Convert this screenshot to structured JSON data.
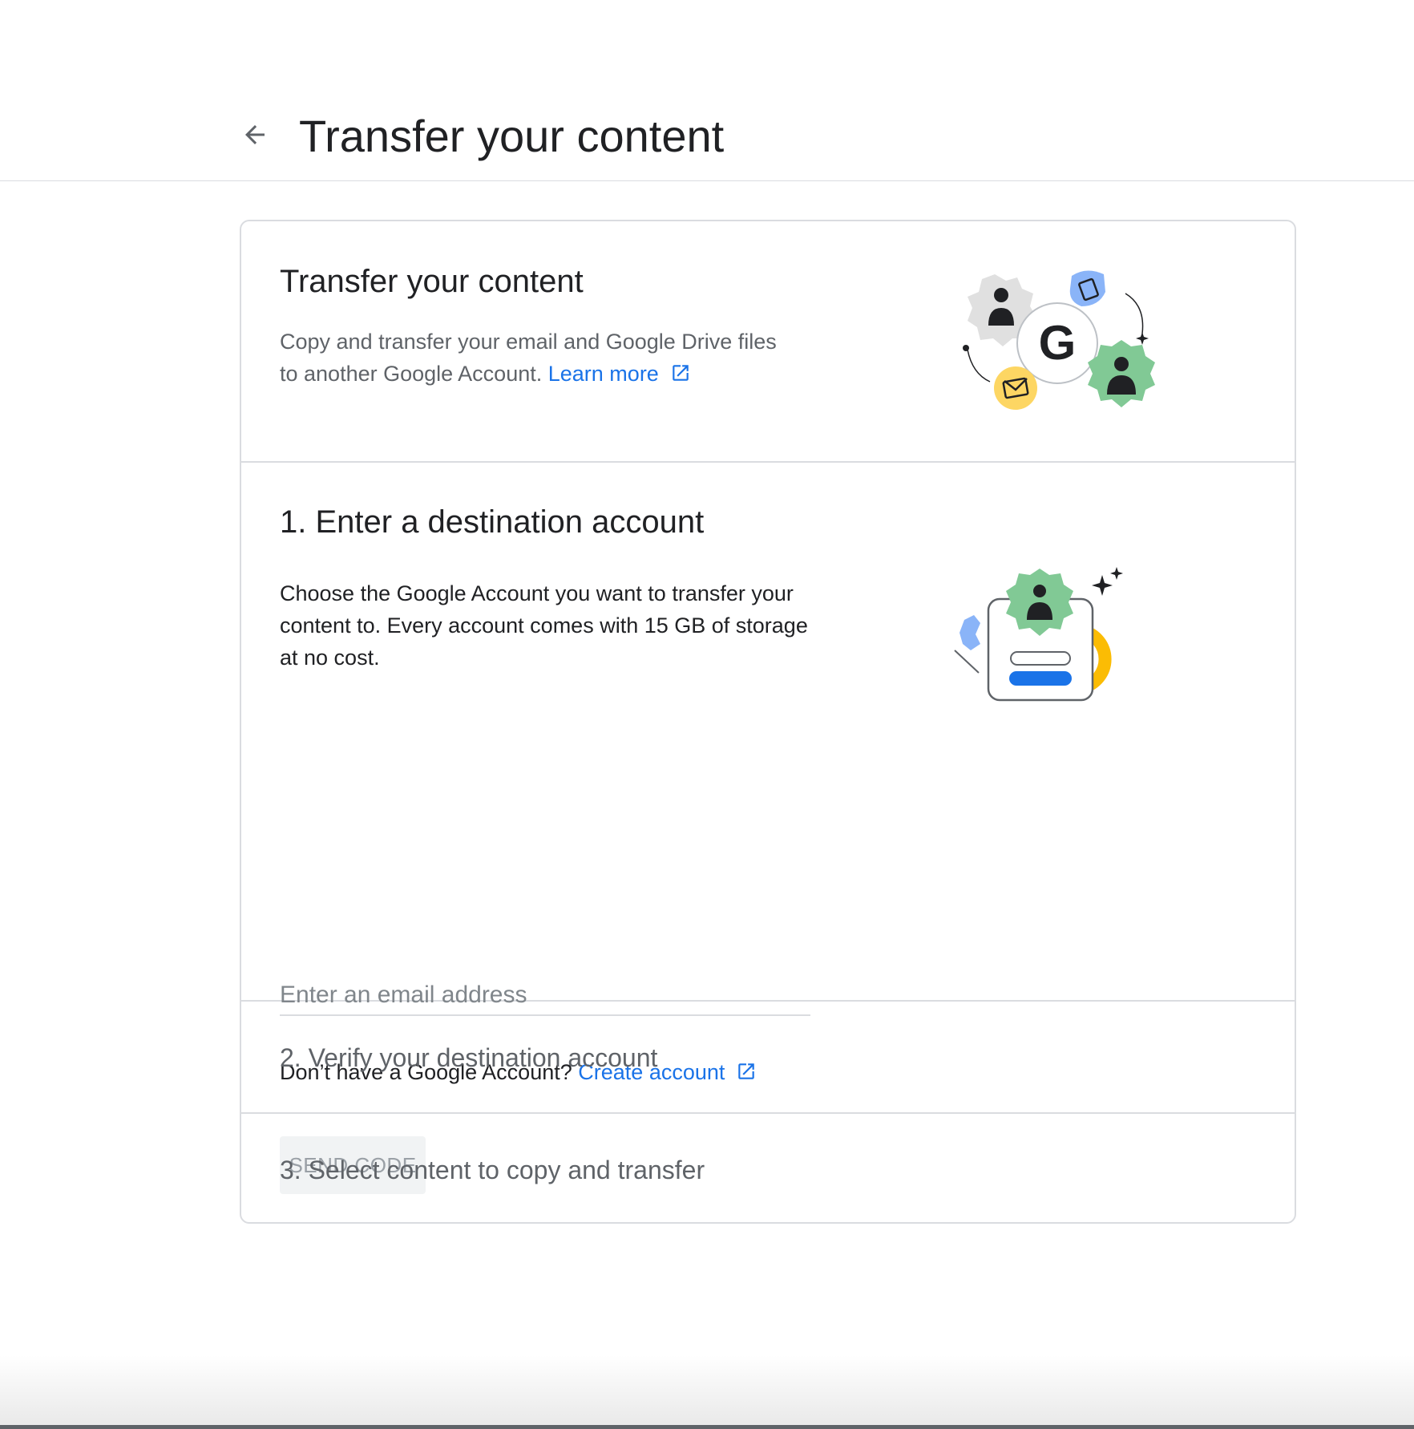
{
  "header": {
    "title": "Transfer your content",
    "back_icon": "arrow-back-icon"
  },
  "intro": {
    "title": "Transfer your content",
    "description": "Copy and transfer your email and Google Drive files to another Google Account.",
    "learn_more": "Learn more"
  },
  "step1": {
    "title": "1. Enter a destination account",
    "description": "Choose the Google Account you want to transfer your content to. Every account comes with 15 GB of storage at no cost.",
    "email_placeholder": "Enter an email address",
    "email_value": "",
    "no_account_text": "Don’t have a Google Account?",
    "create_account": "Create account",
    "send_code": "SEND CODE"
  },
  "step2": {
    "title": "2. Verify your destination account"
  },
  "step3": {
    "title": "3. Select content to copy and transfer"
  },
  "colors": {
    "link": "#1a73e8",
    "green": "#81c995",
    "blue_light": "#8ab4f8",
    "yellow": "#fdd663",
    "orange": "#fbbc04",
    "blue_bar": "#1a73e8"
  }
}
